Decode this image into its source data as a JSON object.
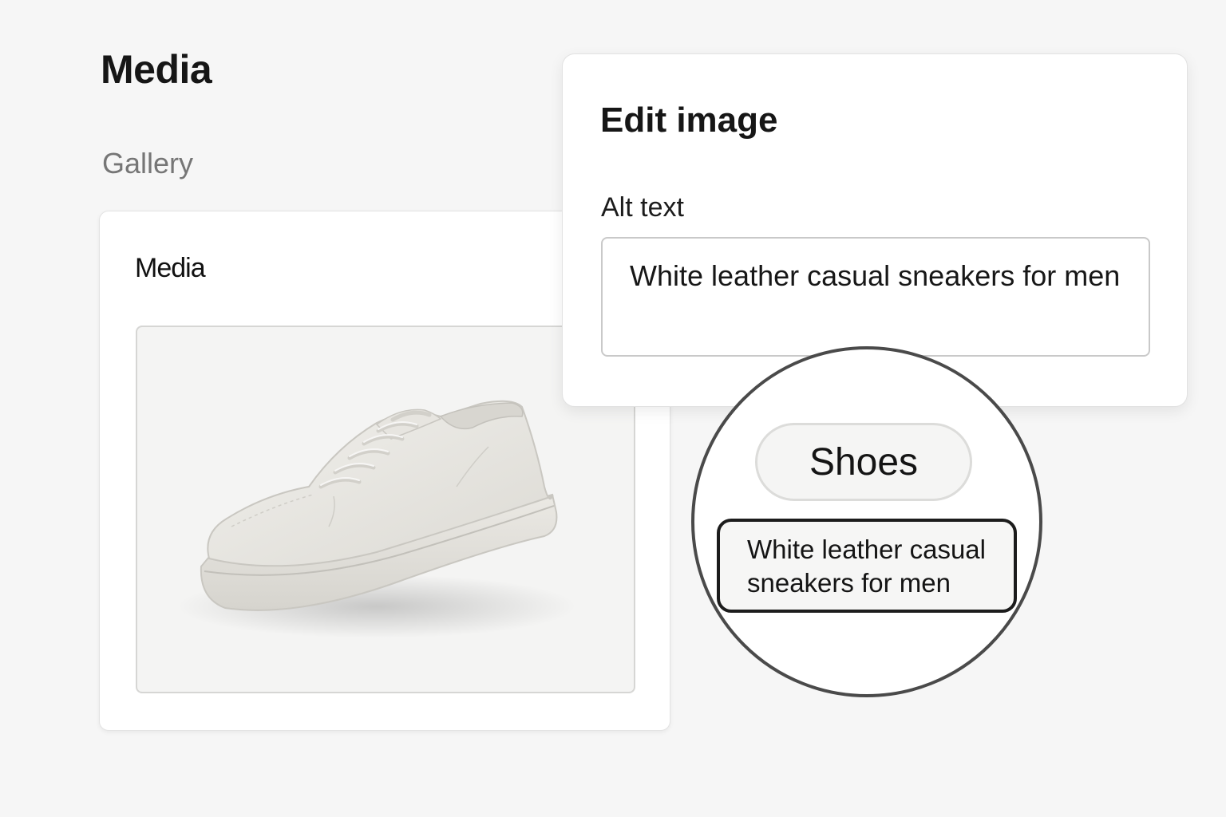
{
  "page": {
    "title": "Media",
    "section": "Gallery"
  },
  "media_card": {
    "title": "Media",
    "image": {
      "icon": "sneaker-image"
    }
  },
  "edit_image": {
    "title": "Edit image",
    "alt_label": "Alt text",
    "alt_value": "White leather casual sneakers for men"
  },
  "magnifier": {
    "tag": "Shoes",
    "alt_preview": "White leather casual sneakers for men"
  },
  "colors": {
    "background": "#f6f6f6",
    "card": "#ffffff",
    "text": "#161616",
    "muted": "#767676",
    "circle_border": "#4a4a4a"
  }
}
